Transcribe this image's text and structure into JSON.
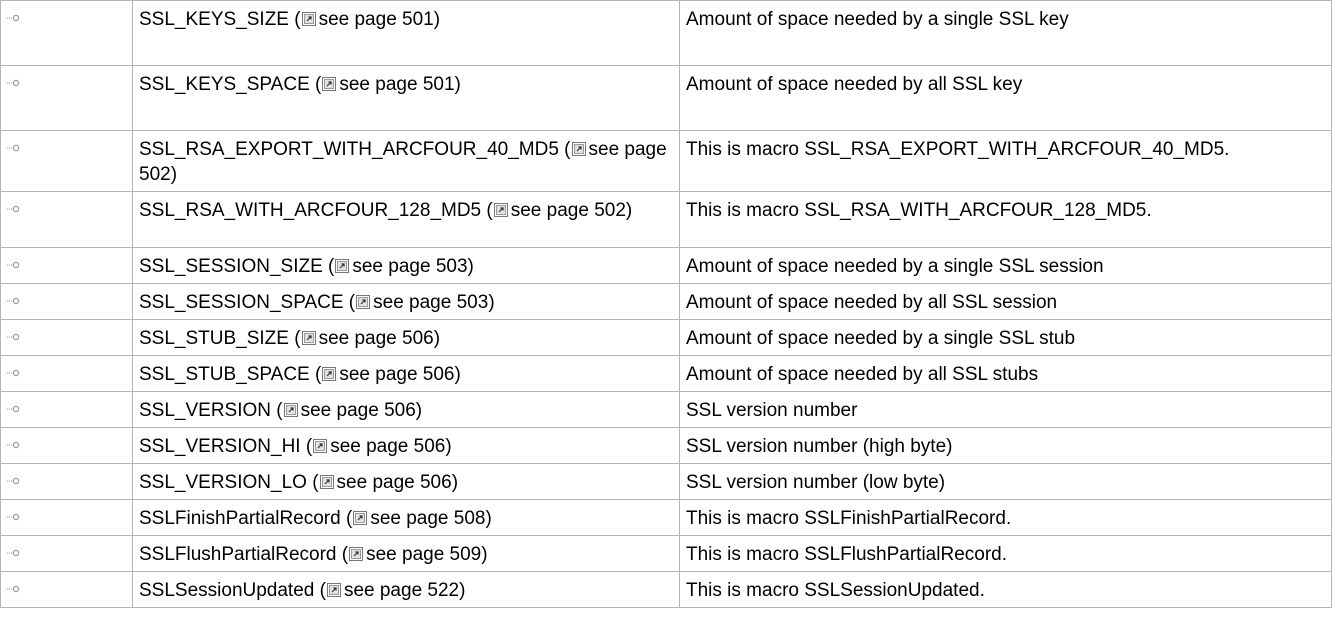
{
  "table": {
    "rows": [
      {
        "name": "SSL_KEYS_SIZE",
        "see": "see page 501",
        "description": "Amount of space needed by a single SSL key"
      },
      {
        "name": "SSL_KEYS_SPACE",
        "see": "see page 501",
        "description": "Amount of space needed by all SSL key"
      },
      {
        "name": "SSL_RSA_EXPORT_WITH_ARCFOUR_40_MD5",
        "see": "see page 502",
        "description": "This is macro SSL_RSA_EXPORT_WITH_ARCFOUR_40_MD5."
      },
      {
        "name": "SSL_RSA_WITH_ARCFOUR_128_MD5",
        "see": "see page 502",
        "description": "This is macro SSL_RSA_WITH_ARCFOUR_128_MD5."
      },
      {
        "name": "SSL_SESSION_SIZE",
        "see": "see page 503",
        "description": "Amount of space needed by a single SSL session"
      },
      {
        "name": "SSL_SESSION_SPACE",
        "see": "see page 503",
        "description": "Amount of space needed by all SSL session"
      },
      {
        "name": "SSL_STUB_SIZE",
        "see": "see page 506",
        "description": "Amount of space needed by a single SSL stub"
      },
      {
        "name": "SSL_STUB_SPACE",
        "see": "see page 506",
        "description": "Amount of space needed by all SSL stubs"
      },
      {
        "name": "SSL_VERSION",
        "see": "see page 506",
        "description": "SSL version number"
      },
      {
        "name": "SSL_VERSION_HI",
        "see": "see page 506",
        "description": "SSL version number (high byte)"
      },
      {
        "name": "SSL_VERSION_LO",
        "see": "see page 506",
        "description": "SSL version number (low byte)"
      },
      {
        "name": "SSLFinishPartialRecord",
        "see": "see page 508",
        "description": "This is macro SSLFinishPartialRecord."
      },
      {
        "name": "SSLFlushPartialRecord",
        "see": "see page 509",
        "description": "This is macro SSLFlushPartialRecord."
      },
      {
        "name": "SSLSessionUpdated",
        "see": "see page 522",
        "description": "This is macro SSLSessionUpdated."
      }
    ]
  },
  "icons": {
    "row_icon": "macro-icon",
    "link_icon": "link-arrow-icon"
  },
  "colors": {
    "border": "#b4b4b4",
    "icon": "#9a9a9a",
    "text": "#000000"
  }
}
